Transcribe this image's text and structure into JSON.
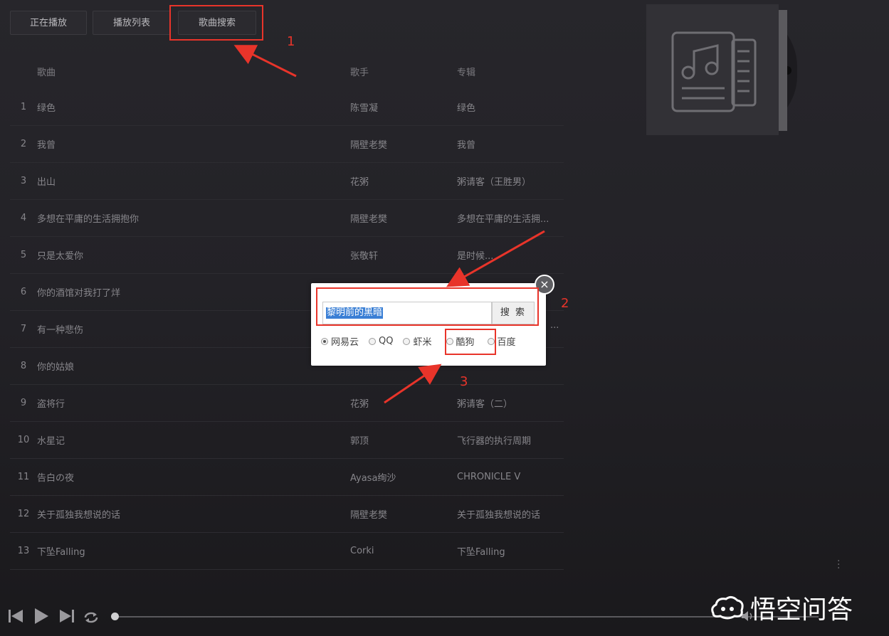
{
  "tabs": {
    "now_playing": "正在播放",
    "playlist": "播放列表",
    "song_search": "歌曲搜索"
  },
  "table": {
    "headers": {
      "song": "歌曲",
      "artist": "歌手",
      "album": "专辑"
    },
    "rows": [
      {
        "idx": "1",
        "song": "绿色",
        "artist": "陈雪凝",
        "album": "绿色"
      },
      {
        "idx": "2",
        "song": "我曾",
        "artist": "隔壁老樊",
        "album": "我曾"
      },
      {
        "idx": "3",
        "song": "出山",
        "artist": "花粥",
        "album": "粥请客（王胜男）"
      },
      {
        "idx": "4",
        "song": "多想在平庸的生活拥抱你",
        "artist": "隔壁老樊",
        "album": "多想在平庸的生活拥..."
      },
      {
        "idx": "5",
        "song": "只是太爱你",
        "artist": "张敬轩",
        "album": "是时候..."
      },
      {
        "idx": "6",
        "song": "你的酒馆对我打了烊",
        "artist": "",
        "album": ""
      },
      {
        "idx": "7",
        "song": "有一种悲伤",
        "artist": "",
        "album": ""
      },
      {
        "idx": "8",
        "song": "你的姑娘",
        "artist": "",
        "album": ""
      },
      {
        "idx": "9",
        "song": "盗将行",
        "artist": "花粥",
        "album": "粥请客（二）"
      },
      {
        "idx": "10",
        "song": "水星记",
        "artist": "郭顶",
        "album": "飞行器的执行周期"
      },
      {
        "idx": "11",
        "song": "告白の夜",
        "artist": "Ayasa绚沙",
        "album": "CHRONICLE V"
      },
      {
        "idx": "12",
        "song": "关于孤独我想说的话",
        "artist": "隔壁老樊",
        "album": "关于孤独我想说的话"
      },
      {
        "idx": "13",
        "song": "下坠Falling",
        "artist": "Corki",
        "album": "下坠Falling"
      }
    ],
    "row7_ellipsis": "..."
  },
  "dialog": {
    "search_value": "黎明前的黑暗",
    "search_button": "搜 索",
    "close_glyph": "×",
    "sources": [
      {
        "label": "网易云",
        "selected": true
      },
      {
        "label": "QQ",
        "selected": false
      },
      {
        "label": "虾米",
        "selected": false
      },
      {
        "label": "酷狗",
        "selected": false
      },
      {
        "label": "百度",
        "selected": false
      }
    ]
  },
  "annotations": {
    "one": "1",
    "two": "2",
    "three": "3"
  },
  "watermark": {
    "text": "悟空问答"
  },
  "colors": {
    "annotation_red": "#e8342a",
    "selection_blue": "#3a7fd5",
    "background": "#232227"
  },
  "icons": {
    "prev": "skip-previous-icon",
    "play": "play-icon",
    "next": "skip-next-icon",
    "loop": "loop-icon",
    "volume": "volume-icon",
    "cover": "music-note-document-icon",
    "close": "close-icon",
    "more": "more-vertical-icon",
    "watermark": "wukong-cloud-icon"
  }
}
